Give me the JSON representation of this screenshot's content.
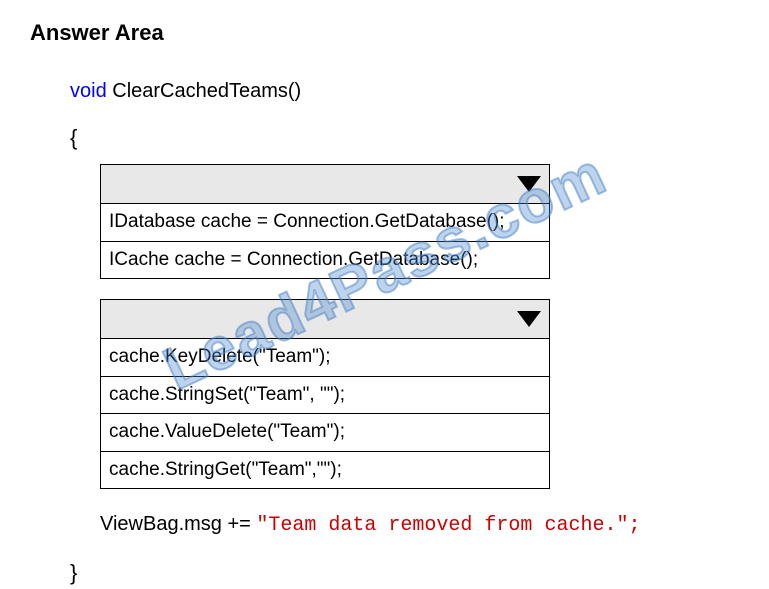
{
  "title": "Answer Area",
  "code": {
    "keyword": "void",
    "method": "ClearCachedTeams()",
    "openBrace": "{",
    "closeBrace": "}",
    "lastLinePrefix": "ViewBag.msg += ",
    "lastLineString": "\"Team data removed from cache.\";"
  },
  "dropdown1": {
    "options": [
      "IDatabase cache = Connection.GetDatabase();",
      "ICache cache = Connection.GetDatabase();"
    ]
  },
  "dropdown2": {
    "options": [
      "cache.KeyDelete(\"Team\");",
      "cache.StringSet(\"Team\", \"\");",
      "cache.ValueDelete(\"Team\");",
      "cache.StringGet(\"Team\",\"\");"
    ]
  },
  "watermark": "Lead4Pass.com"
}
